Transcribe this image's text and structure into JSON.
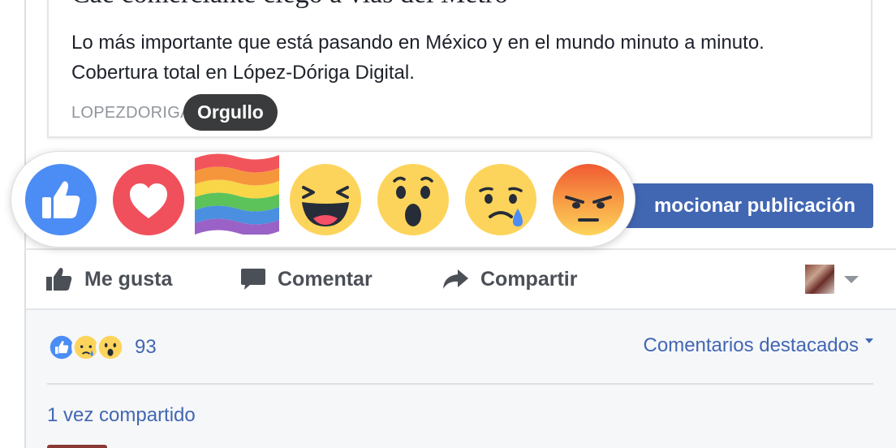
{
  "preview": {
    "title": "Cae comerciante ciego a vías del Metro",
    "description": "Lo más importante que está pasando en México y en el mundo minuto a minuto. Cobertura total en López-Dóriga Digital.",
    "domain": "LOPEZDORIGA"
  },
  "tooltip": {
    "label": "Orgullo"
  },
  "promote_button": {
    "label": "mocionar publicación"
  },
  "reaction_bar": {
    "items": [
      {
        "name": "like",
        "icon": "like-reaction-icon"
      },
      {
        "name": "love",
        "icon": "love-reaction-icon"
      },
      {
        "name": "pride",
        "icon": "pride-flag-reaction-icon"
      },
      {
        "name": "haha",
        "icon": "haha-reaction-icon"
      },
      {
        "name": "wow",
        "icon": "wow-reaction-icon"
      },
      {
        "name": "sad",
        "icon": "sad-reaction-icon"
      },
      {
        "name": "angry",
        "icon": "angry-reaction-icon"
      }
    ]
  },
  "actions": {
    "like_label": "Me gusta",
    "comment_label": "Comentar",
    "share_label": "Compartir"
  },
  "summary": {
    "reaction_count": "93",
    "featured_comments_label": "Comentarios destacados",
    "shares_label": "1 vez compartido"
  },
  "colors": {
    "facebook_blue": "#4267b2",
    "link_blue": "#4267b2",
    "like_blue": "#4c8cf5",
    "love_red": "#f0505c",
    "emoji_yellow": "#fdd45b",
    "angry_red": "#f05a32"
  }
}
